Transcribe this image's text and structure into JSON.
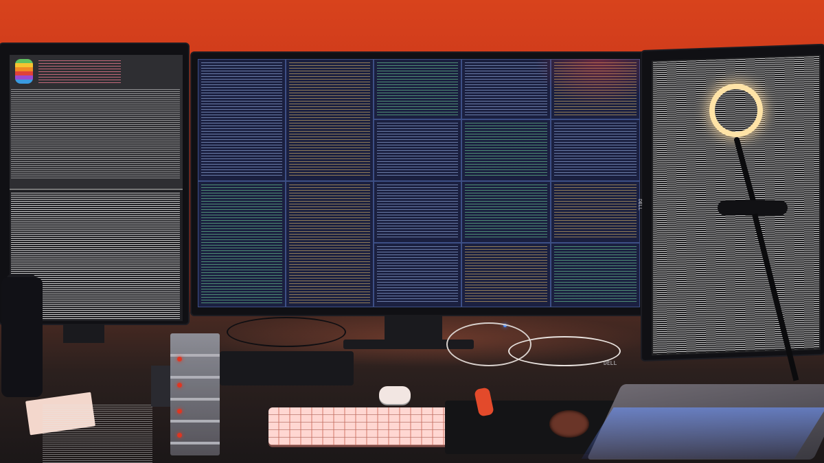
{
  "scene": {
    "description_colors": {
      "wall": "#d8431c",
      "terminal_background": "#1e2342",
      "pane_border": "#3d4f86",
      "ring_light": "#ffe3a6",
      "keyboard": "#f6c9c2",
      "led": "#ff3b24"
    }
  },
  "monitors": {
    "center": {
      "brand": "DELL"
    },
    "right": {
      "brand": "DELL"
    }
  },
  "icons": {
    "apple_logo": ""
  }
}
